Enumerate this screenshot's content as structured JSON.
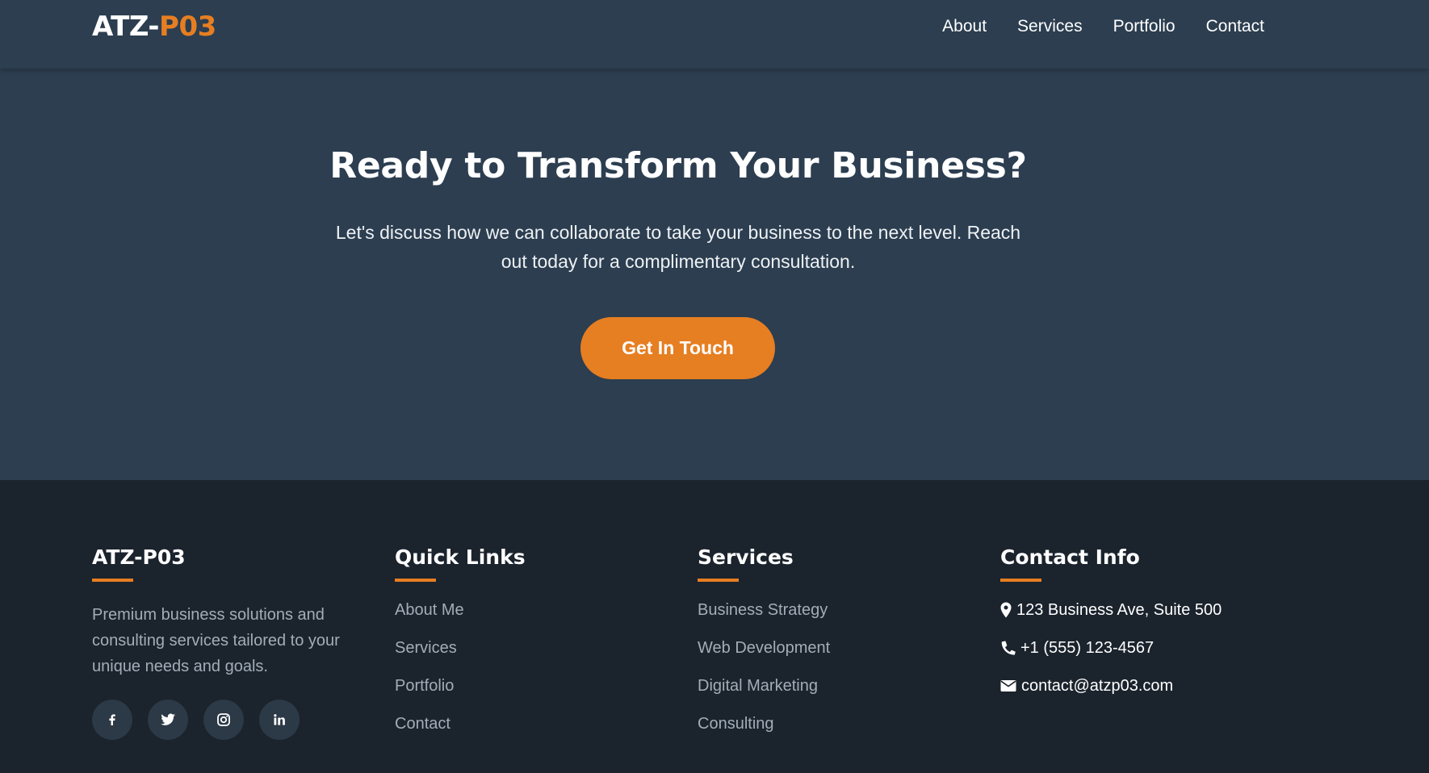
{
  "header": {
    "logo_main": "ATZ-",
    "logo_accent": "P03",
    "nav": [
      "About",
      "Services",
      "Portfolio",
      "Contact"
    ]
  },
  "hero": {
    "title": "Ready to Transform Your Business?",
    "text": "Let's discuss how we can collaborate to take your business to the next level. Reach out today for a complimentary consultation.",
    "cta_label": "Get In Touch"
  },
  "footer": {
    "brand": {
      "title": "ATZ-P03",
      "description": "Premium business solutions and consulting services tailored to your unique needs and goals.",
      "socials": [
        "facebook-icon",
        "twitter-icon",
        "instagram-icon",
        "linkedin-icon"
      ]
    },
    "quick_links": {
      "title": "Quick Links",
      "items": [
        "About Me",
        "Services",
        "Portfolio",
        "Contact"
      ]
    },
    "services": {
      "title": "Services",
      "items": [
        "Business Strategy",
        "Web Development",
        "Digital Marketing",
        "Consulting"
      ]
    },
    "contact": {
      "title": "Contact Info",
      "address": "123 Business Ave, Suite 500",
      "phone": "+1 (555) 123-4567",
      "email": "contact@atzp03.com"
    }
  },
  "colors": {
    "accent": "#e67e22",
    "header_bg": "#2c3e50",
    "footer_bg": "#1b232d"
  }
}
